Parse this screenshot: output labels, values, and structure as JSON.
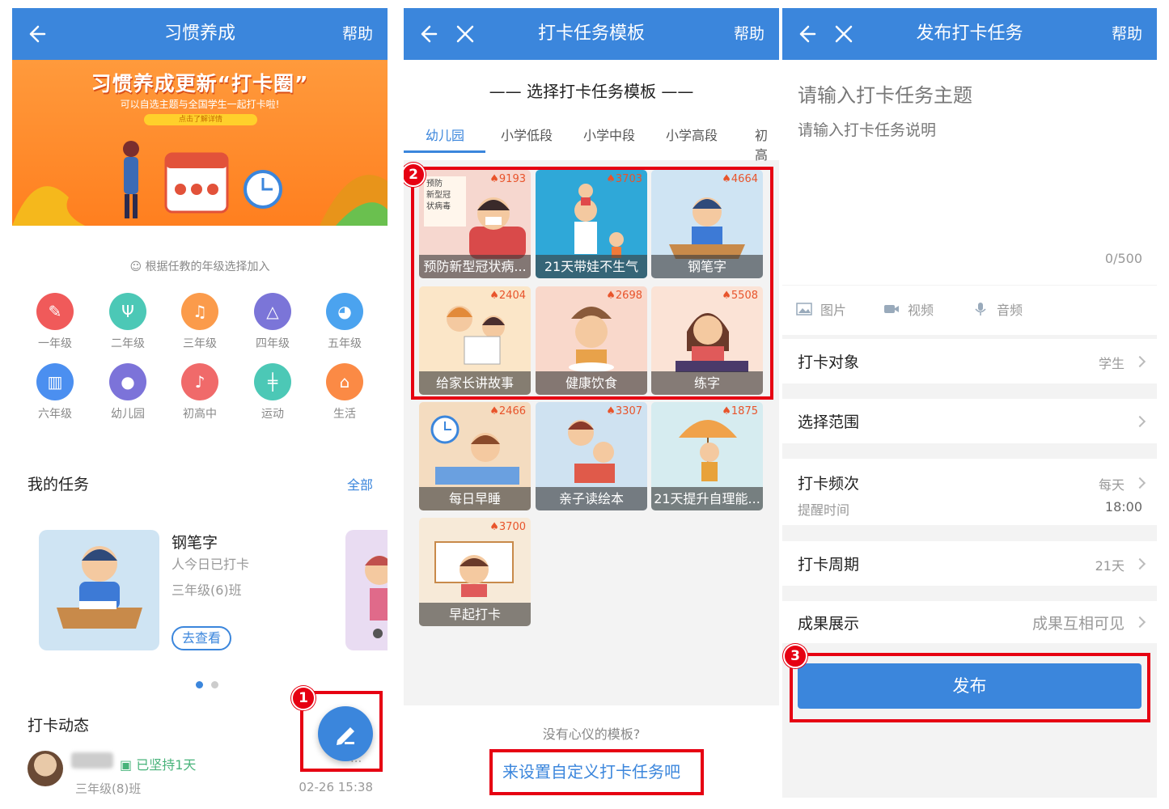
{
  "p1": {
    "header": {
      "title": "习惯养成",
      "help": "帮助"
    },
    "banner": {
      "title": "习惯养成更新“打卡圈”",
      "subtitle": "可以自选主题与全国学生一起打卡啦!",
      "button": "点击了解详情"
    },
    "hint": "根据任教的年级选择加入",
    "grades": [
      "一年级",
      "二年级",
      "三年级",
      "四年级",
      "五年级",
      "六年级",
      "幼儿园",
      "初高中",
      "运动",
      "生活"
    ],
    "my_tasks": {
      "label": "我的任务",
      "all": "全部"
    },
    "task": {
      "title": "钢笔字",
      "checked": "人今日已打卡",
      "class": "三年级(6)班",
      "button": "去查看"
    },
    "feed": {
      "label": "打卡动态",
      "streak": "已坚持1天",
      "class": "三年级(8)班",
      "time": "02-26 15:38",
      "more": "..."
    },
    "step": "1"
  },
  "p2": {
    "header": {
      "title": "打卡任务模板",
      "help": "帮助"
    },
    "select_title": "—— 选择打卡任务模板 ——",
    "tabs": [
      "幼儿园",
      "小学低段",
      "小学中段",
      "小学高段",
      "初高"
    ],
    "templates": [
      {
        "name": "预防新型冠状病...",
        "count": "9193",
        "bg": "#f6d7cf"
      },
      {
        "name": "21天带娃不生气",
        "count": "3703",
        "bg": "#2fa8d8"
      },
      {
        "name": "钢笔字",
        "count": "4664",
        "bg": "#cfe4f3"
      },
      {
        "name": "给家长讲故事",
        "count": "2404",
        "bg": "#fbe6c8"
      },
      {
        "name": "健康饮食",
        "count": "2698",
        "bg": "#f9d8cb"
      },
      {
        "name": "练字",
        "count": "5508",
        "bg": "#fbe3d6"
      },
      {
        "name": "每日早睡",
        "count": "2466",
        "bg": "#f4dcc0"
      },
      {
        "name": "亲子读绘本",
        "count": "3307",
        "bg": "#cfe2f1"
      },
      {
        "name": "21天提升自理能...",
        "count": "1875",
        "bg": "#d6ecf0"
      },
      {
        "name": "早起打卡",
        "count": "3700",
        "bg": "#f7ead8"
      }
    ],
    "poster_text": "预防\n新型冠\n状病毒",
    "footer": {
      "question": "没有心仪的模板?",
      "link": "来设置自定义打卡任务吧"
    },
    "step": "2"
  },
  "p3": {
    "header": {
      "title": "发布打卡任务",
      "help": "帮助"
    },
    "topic_placeholder": "请输入打卡任务主题",
    "desc_placeholder": "请输入打卡任务说明",
    "counter": "0/500",
    "media": [
      "图片",
      "视频",
      "音频"
    ],
    "rows": {
      "target": {
        "label": "打卡对象",
        "value": "学生"
      },
      "scope": {
        "label": "选择范围"
      },
      "freq": {
        "label": "打卡频次",
        "value": "每天",
        "sub_label": "提醒时间",
        "sub_value": "18:00"
      },
      "period": {
        "label": "打卡周期",
        "value": "21天"
      },
      "result": {
        "label": "成果展示",
        "value": "成果互相可见"
      }
    },
    "publish": "发布",
    "step": "3"
  },
  "colors": {
    "primary": "#3b86dc",
    "highlight": "#e60012",
    "banner": "#ff8a2a"
  }
}
